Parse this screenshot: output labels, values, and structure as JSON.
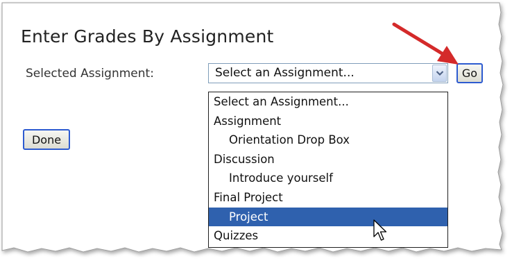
{
  "page": {
    "title": "Enter Grades By Assignment",
    "assignment_label": "Selected Assignment:"
  },
  "select": {
    "selected_value": "Select an Assignment...",
    "go_label": "Go",
    "options": [
      {
        "label": "Select an Assignment...",
        "kind": "option"
      },
      {
        "label": "Assignment",
        "kind": "group"
      },
      {
        "label": "Orientation Drop Box",
        "kind": "item"
      },
      {
        "label": "Discussion",
        "kind": "group"
      },
      {
        "label": "Introduce yourself",
        "kind": "item"
      },
      {
        "label": "Final Project",
        "kind": "group"
      },
      {
        "label": "Project",
        "kind": "item",
        "highlighted": true
      },
      {
        "label": "Quizzes",
        "kind": "group"
      }
    ]
  },
  "actions": {
    "done_label": "Done"
  },
  "icons": {
    "dropdown": "chevron-down-icon",
    "pointer": "mouse-pointer-icon",
    "annotation": "red-arrow-icon"
  },
  "colors": {
    "highlight": "#2f61ae",
    "button_border": "#2d5bd0",
    "annotation_arrow": "#d42a2a"
  }
}
